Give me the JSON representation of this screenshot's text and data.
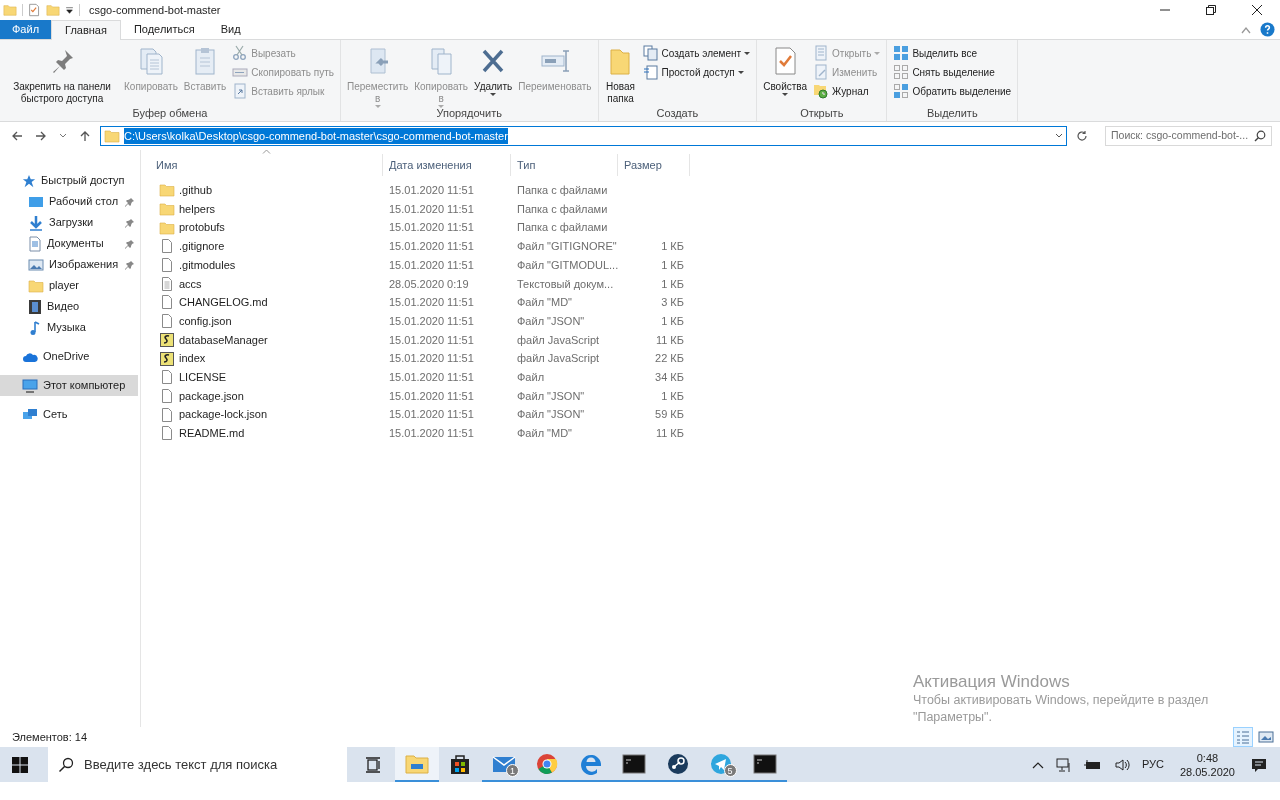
{
  "window": {
    "title": "csgo-commend-bot-master"
  },
  "ribbon_tabs": [
    {
      "label": "Файл",
      "kind": "file",
      "selected": false
    },
    {
      "label": "Главная",
      "kind": "tab",
      "selected": true
    },
    {
      "label": "Поделиться",
      "kind": "tab",
      "selected": false
    },
    {
      "label": "Вид",
      "kind": "tab",
      "selected": false
    }
  ],
  "ribbon_groups": [
    {
      "label": "Буфер обмена",
      "items": [
        {
          "label": "Закрепить на панели быстрого доступа",
          "kind": "large",
          "disabled": false,
          "dropdown": false
        },
        {
          "label": "Копировать",
          "kind": "large",
          "disabled": true,
          "dropdown": false
        },
        {
          "label": "Вставить",
          "kind": "large",
          "disabled": true,
          "dropdown": false
        },
        {
          "label": "Вырезать",
          "kind": "small",
          "disabled": true,
          "dropdown": false
        },
        {
          "label": "Скопировать путь",
          "kind": "small",
          "disabled": true,
          "dropdown": false
        },
        {
          "label": "Вставить ярлык",
          "kind": "small",
          "disabled": true,
          "dropdown": false
        }
      ]
    },
    {
      "label": "Упорядочить",
      "items": [
        {
          "label": "Переместить\nв",
          "kind": "large",
          "disabled": true,
          "dropdown": true
        },
        {
          "label": "Копировать\nв",
          "kind": "large",
          "disabled": true,
          "dropdown": true
        },
        {
          "label": "Удалить",
          "kind": "large",
          "disabled": false,
          "dropdown": true
        },
        {
          "label": "Переименовать",
          "kind": "large",
          "disabled": true,
          "dropdown": false
        }
      ]
    },
    {
      "label": "Создать",
      "items": [
        {
          "label": "Новая\nпапка",
          "kind": "large",
          "disabled": false,
          "dropdown": false
        },
        {
          "label": "Создать элемент",
          "kind": "small",
          "disabled": false,
          "dropdown": true
        },
        {
          "label": "Простой доступ",
          "kind": "small",
          "disabled": false,
          "dropdown": true
        }
      ]
    },
    {
      "label": "Открыть",
      "items": [
        {
          "label": "Свойства",
          "kind": "large",
          "disabled": false,
          "dropdown": true
        },
        {
          "label": "Открыть",
          "kind": "small",
          "disabled": true,
          "dropdown": true
        },
        {
          "label": "Изменить",
          "kind": "small",
          "disabled": true,
          "dropdown": false
        },
        {
          "label": "Журнал",
          "kind": "small",
          "disabled": false,
          "dropdown": false
        }
      ]
    },
    {
      "label": "Выделить",
      "items": [
        {
          "label": "Выделить все",
          "kind": "small",
          "disabled": false,
          "dropdown": false
        },
        {
          "label": "Снять выделение",
          "kind": "small",
          "disabled": false,
          "dropdown": false
        },
        {
          "label": "Обратить выделение",
          "kind": "small",
          "disabled": false,
          "dropdown": false
        }
      ]
    }
  ],
  "address": {
    "path": "C:\\Users\\kolka\\Desktop\\csgo-commend-bot-master\\csgo-commend-bot-master",
    "selected": true
  },
  "search": {
    "placeholder": "Поиск: csgo-commend-bot-..."
  },
  "sidebar": {
    "items": [
      {
        "label": "Быстрый доступ",
        "pinned": false,
        "selected": false,
        "children": [
          {
            "label": "Рабочий стол",
            "pinned": true,
            "selected": false
          },
          {
            "label": "Загрузки",
            "pinned": true,
            "selected": false
          },
          {
            "label": "Документы",
            "pinned": true,
            "selected": false
          },
          {
            "label": "Изображения",
            "pinned": true,
            "selected": false
          },
          {
            "label": "player",
            "pinned": false,
            "selected": false
          },
          {
            "label": "Видео",
            "pinned": false,
            "selected": false
          },
          {
            "label": "Музыка",
            "pinned": false,
            "selected": false
          }
        ]
      },
      {
        "label": "OneDrive",
        "pinned": false,
        "selected": false
      },
      {
        "label": "Этот компьютер",
        "pinned": false,
        "selected": true
      },
      {
        "label": "Сеть",
        "pinned": false,
        "selected": false
      }
    ]
  },
  "table": {
    "columns": [
      {
        "label": "Имя",
        "sorted": true
      },
      {
        "label": "Дата изменения",
        "sorted": false
      },
      {
        "label": "Тип",
        "sorted": false
      },
      {
        "label": "Размер",
        "sorted": false
      }
    ],
    "rows": [
      {
        "name": ".github",
        "date": "15.01.2020 11:51",
        "type": "Папка с файлами",
        "size": "",
        "kind": "folder",
        "selected": false
      },
      {
        "name": "helpers",
        "date": "15.01.2020 11:51",
        "type": "Папка с файлами",
        "size": "",
        "kind": "folder",
        "selected": false
      },
      {
        "name": "protobufs",
        "date": "15.01.2020 11:51",
        "type": "Папка с файлами",
        "size": "",
        "kind": "folder",
        "selected": false
      },
      {
        "name": ".gitignore",
        "date": "15.01.2020 11:51",
        "type": "Файл \"GITIGNORE\"",
        "size": "1 КБ",
        "kind": "file",
        "selected": false
      },
      {
        "name": ".gitmodules",
        "date": "15.01.2020 11:51",
        "type": "Файл \"GITMODUL...",
        "size": "1 КБ",
        "kind": "file",
        "selected": false
      },
      {
        "name": "accs",
        "date": "28.05.2020 0:19",
        "type": "Текстовый докум...",
        "size": "1 КБ",
        "kind": "text",
        "selected": false
      },
      {
        "name": "CHANGELOG.md",
        "date": "15.01.2020 11:51",
        "type": "Файл \"MD\"",
        "size": "3 КБ",
        "kind": "file",
        "selected": false
      },
      {
        "name": "config.json",
        "date": "15.01.2020 11:51",
        "type": "Файл \"JSON\"",
        "size": "1 КБ",
        "kind": "file",
        "selected": false
      },
      {
        "name": "databaseManager",
        "date": "15.01.2020 11:51",
        "type": "файл JavaScript",
        "size": "11 КБ",
        "kind": "script",
        "selected": false
      },
      {
        "name": "index",
        "date": "15.01.2020 11:51",
        "type": "файл JavaScript",
        "size": "22 КБ",
        "kind": "script",
        "selected": false
      },
      {
        "name": "LICENSE",
        "date": "15.01.2020 11:51",
        "type": "Файл",
        "size": "34 КБ",
        "kind": "file",
        "selected": false
      },
      {
        "name": "package.json",
        "date": "15.01.2020 11:51",
        "type": "Файл \"JSON\"",
        "size": "1 КБ",
        "kind": "file",
        "selected": false
      },
      {
        "name": "package-lock.json",
        "date": "15.01.2020 11:51",
        "type": "Файл \"JSON\"",
        "size": "59 КБ",
        "kind": "file",
        "selected": false
      },
      {
        "name": "README.md",
        "date": "15.01.2020 11:51",
        "type": "Файл \"MD\"",
        "size": "11 КБ",
        "kind": "file",
        "selected": false
      }
    ]
  },
  "activation_notice": {
    "title": "Активация Windows",
    "text": "Чтобы активировать Windows, перейдите в раздел \"Параметры\"."
  },
  "status_bar": {
    "text": "Элементов: 14",
    "views": [
      {
        "selected": true
      },
      {
        "selected": false
      }
    ]
  },
  "taskbar": {
    "search_placeholder": "Введите здесь текст для поиска",
    "apps": [
      {
        "active": true,
        "running": true
      },
      {
        "active": false,
        "running": false
      },
      {
        "active": false,
        "running": true,
        "badge": "1"
      },
      {
        "active": false,
        "running": true
      },
      {
        "active": false,
        "running": true
      },
      {
        "active": false,
        "running": true
      },
      {
        "active": false,
        "running": true
      },
      {
        "active": false,
        "running": true,
        "badge": "5"
      },
      {
        "active": false,
        "running": true
      }
    ],
    "language": "РУС",
    "time": "0:48",
    "date": "28.05.2020"
  }
}
